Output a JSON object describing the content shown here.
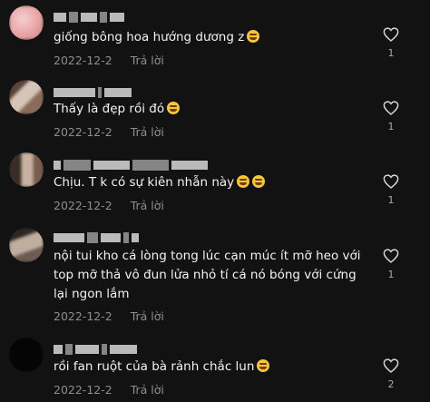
{
  "comments": [
    {
      "text": "giống bông hoa hướng dương z",
      "emoji": "😂",
      "date": "2022-12-2",
      "reply": "Trả lời",
      "likes": "1",
      "avatar_colors": [
        "#e8a3a3",
        "#f4d0d0",
        "#c97c7c"
      ]
    },
    {
      "text": "Thấy là đẹp rồi đó",
      "emoji": "😂",
      "date": "2022-12-2",
      "reply": "Trả lời",
      "likes": "1",
      "avatar_colors": [
        "#8c6b5a",
        "#d5c4b8",
        "#5a4438"
      ]
    },
    {
      "text": "Chịu. T k có sự kiên nhẫn này",
      "emoji": "😂😂",
      "date": "2022-12-2",
      "reply": "Trả lời",
      "likes": "1",
      "avatar_colors": [
        "#7a5d4f",
        "#c9b2a2",
        "#3a2d26"
      ]
    },
    {
      "text": "nội tui kho cá lòng tong lúc cạn múc ít mỡ heo với top mỡ thả vô đun lửa nhỏ tí cá nó bóng với cứng lại ngon lắm",
      "emoji": "",
      "date": "2022-12-2",
      "reply": "Trả lời",
      "likes": "1",
      "avatar_colors": [
        "#6d5a52",
        "#bfae9e",
        "#2e2622"
      ]
    },
    {
      "text": "rồi fan ruột của bà rảnh chắc lun",
      "emoji": "😂",
      "date": "2022-12-2",
      "reply": "Trả lời",
      "likes": "2",
      "avatar_colors": [
        "#050505",
        "#0a0a0a",
        "#000000"
      ]
    }
  ]
}
